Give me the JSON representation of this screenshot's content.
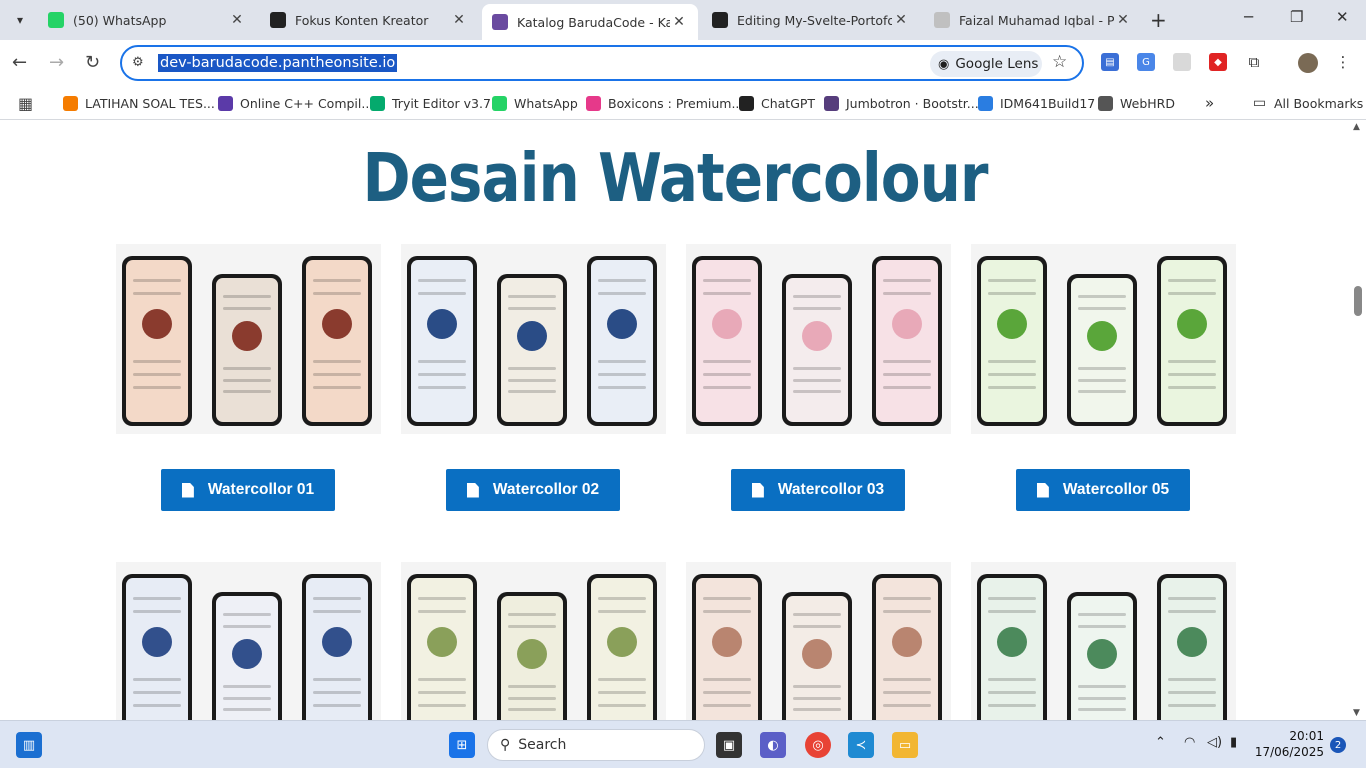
{
  "browser": {
    "tabs": [
      {
        "title": "(50) WhatsApp",
        "icon": "whatsapp-icon",
        "color": "#25d366",
        "active": false
      },
      {
        "title": "Fokus Konten Kreator",
        "icon": "chatgpt-icon",
        "color": "#222222",
        "active": false
      },
      {
        "title": "Katalog BarudaCode - Katalo",
        "icon": "site-favicon",
        "color": "#6a4aa0",
        "active": true
      },
      {
        "title": "Editing My-Svelte-Portofolio",
        "icon": "github-icon",
        "color": "#222222",
        "active": false
      },
      {
        "title": "Faizal Muhamad Iqbal - Port",
        "icon": "svelte-icon",
        "color": "#c0c0c0",
        "active": false
      }
    ],
    "url": "dev-barudacode.pantheonsite.io",
    "lens_label": "Google Lens",
    "bookmarks": [
      {
        "label": "LATIHAN SOAL TES...",
        "icon": "blogger-icon",
        "color": "#f57c00"
      },
      {
        "label": "Online C++ Compil...",
        "icon": "bolt-icon",
        "color": "#5b3aa8"
      },
      {
        "label": "Tryit Editor v3.7",
        "icon": "w3-icon",
        "color": "#04aa6d"
      },
      {
        "label": "WhatsApp",
        "icon": "whatsapp-icon",
        "color": "#25d366"
      },
      {
        "label": "Boxicons : Premium...",
        "icon": "boxicons-icon",
        "color": "#e6398a"
      },
      {
        "label": "ChatGPT",
        "icon": "chatgpt-icon",
        "color": "#222222"
      },
      {
        "label": "Jumbotron · Bootstr...",
        "icon": "bootstrap-icon",
        "color": "#563d7c"
      },
      {
        "label": "IDM641Build17",
        "icon": "idm-icon",
        "color": "#2a7de1"
      },
      {
        "label": "WebHRD",
        "icon": "globe-icon",
        "color": "#555555"
      }
    ],
    "all_bookmarks": "All Bookmarks"
  },
  "page": {
    "heading": "Desain Watercolour",
    "cards": [
      {
        "label": "Watercollor 01",
        "palette": [
          "#f3d9c8",
          "#8a3b2e",
          "#eae0d6"
        ]
      },
      {
        "label": "Watercollor 02",
        "palette": [
          "#e9eef6",
          "#2a4c86",
          "#f1ede4"
        ]
      },
      {
        "label": "Watercollor 03",
        "palette": [
          "#f7e1e6",
          "#e8a9b8",
          "#f4eced"
        ]
      },
      {
        "label": "Watercollor 05",
        "palette": [
          "#eaf5df",
          "#5aa63a",
          "#f1f6ec"
        ]
      }
    ],
    "row2": [
      {
        "palette": [
          "#e7ecf5",
          "#32508c",
          "#eef0f6"
        ]
      },
      {
        "palette": [
          "#f2f1e2",
          "#8aa05a",
          "#efeede"
        ]
      },
      {
        "palette": [
          "#f3e4dc",
          "#b98570",
          "#f3ece6"
        ]
      },
      {
        "palette": [
          "#e8f2ea",
          "#4c8a5c",
          "#eef5ef"
        ]
      }
    ]
  },
  "taskbar": {
    "search_label": "Search",
    "time": "20:01",
    "date": "17/06/2025",
    "notification_count": "2"
  }
}
